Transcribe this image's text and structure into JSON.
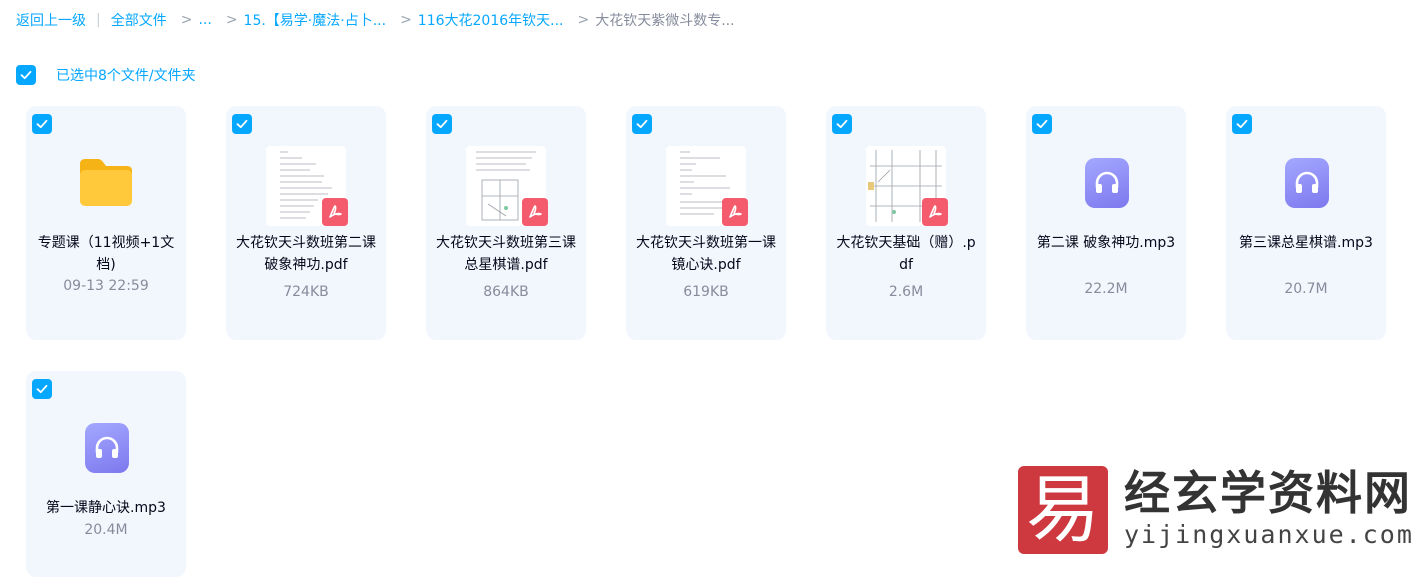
{
  "breadcrumb": {
    "back": "返回上一级",
    "all_files": "全部文件",
    "ellipsis": "...",
    "crumb1": "15.【易学·魔法·占卜...",
    "crumb2": "116大花2016年钦天...",
    "current": "大花钦天紫微斗数专..."
  },
  "selection": {
    "text": "已选中8个文件/文件夹"
  },
  "files": [
    {
      "name": "专题课（11视频+1文档)",
      "meta": "09-13 22:59",
      "type": "folder"
    },
    {
      "name": "大花钦天斗数班第二课 破象神功.pdf",
      "meta": "724KB",
      "type": "pdf"
    },
    {
      "name": "大花钦天斗数班第三课 总星棋谱.pdf",
      "meta": "864KB",
      "type": "pdf"
    },
    {
      "name": "大花钦天斗数班第一课 镜心诀.pdf",
      "meta": "619KB",
      "type": "pdf"
    },
    {
      "name": "大花钦天基础（赠）.pdf",
      "meta": "2.6M",
      "type": "pdf"
    },
    {
      "name": "第二课 破象神功.mp3",
      "meta": "22.2M",
      "type": "audio"
    },
    {
      "name": "第三课总星棋谱.mp3",
      "meta": "20.7M",
      "type": "audio"
    },
    {
      "name": "第一课静心诀.mp3",
      "meta": "20.4M",
      "type": "audio"
    }
  ],
  "watermark": {
    "logo_char": "易",
    "title": "经玄学资料网",
    "url": "yijingxuanxue.com"
  },
  "colors": {
    "accent": "#06a7ff",
    "card_bg": "#f1f7fd",
    "pdf_red": "#f45b6c",
    "audio_purple": "#8f8cf6",
    "folder_yellow": "#ffc62b"
  }
}
